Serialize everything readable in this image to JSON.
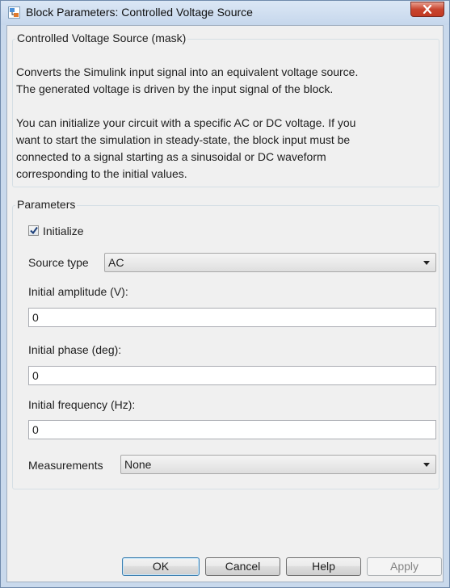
{
  "window": {
    "title": "Block Parameters: Controlled Voltage Source"
  },
  "mask_group": {
    "title": "Controlled Voltage Source (mask)",
    "description_1": "Converts the Simulink input signal into an equivalent voltage source.\nThe generated voltage is driven by the input signal of the block.",
    "description_2": "You can initialize your circuit with a specific AC or DC voltage. If you\nwant to start the simulation in steady-state, the block input must be\nconnected to a signal starting as a sinusoidal or DC waveform\ncorresponding to the initial values."
  },
  "parameters": {
    "title": "Parameters",
    "initialize_label": "Initialize",
    "initialize_checked": true,
    "source_type_label": "Source type",
    "source_type_value": "AC",
    "amplitude_label": "Initial amplitude (V):",
    "amplitude_value": "0",
    "phase_label": "Initial phase (deg):",
    "phase_value": "0",
    "frequency_label": "Initial frequency (Hz):",
    "frequency_value": "0",
    "measurements_label": "Measurements",
    "measurements_value": "None"
  },
  "buttons": {
    "ok": "OK",
    "cancel": "Cancel",
    "help": "Help",
    "apply": "Apply"
  }
}
